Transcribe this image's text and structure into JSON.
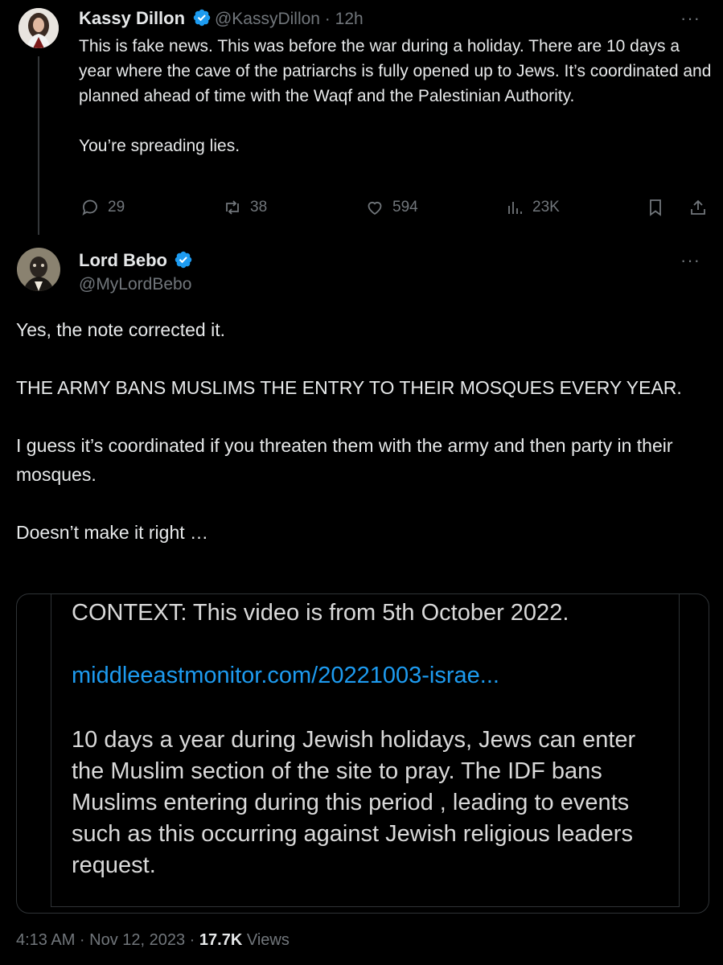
{
  "tweet1": {
    "name": "Kassy Dillon",
    "handle_time": "@KassyDillon · 12h",
    "text": "This is fake news. This was before the war during a holiday. There are 10 days a year where the cave of the patriarchs is fully opened up to Jews. It’s coordinated and planned ahead of time with the Waqf and the Palestinian Authority.\n\nYou’re spreading lies.",
    "replies": "29",
    "reposts": "38",
    "likes": "594",
    "views": "23K",
    "more": "···"
  },
  "tweet2": {
    "name": "Lord Bebo",
    "handle": "@MyLordBebo",
    "more": "···",
    "text": "Yes, the note corrected it.\n\nTHE ARMY BANS MUSLIMS THE ENTRY TO THEIR MOSQUES EVERY YEAR.\n\nI guess it’s coordinated if you threaten them with the army and then party in their mosques.\n\nDoesn’t make it right …",
    "card": {
      "headline": "CONTEXT: This video is from 5th October 2022.",
      "link": "middleeastmonitor.com/20221003-israe...",
      "body": "10 days a year during Jewish holidays, Jews can enter the Muslim section of the site to pray. The IDF bans Muslims entering during this period , leading to events such as this occurring against Jewish religious leaders request."
    },
    "time": "4:13 AM · Nov 12, 2023 · ",
    "views_count": "17.7K",
    "views_label": " Views"
  },
  "colors": {
    "background": "#000000",
    "text": "#e7e9ea",
    "muted": "#71767b",
    "link": "#1d9bf0",
    "verified": "#1d9bf0"
  }
}
